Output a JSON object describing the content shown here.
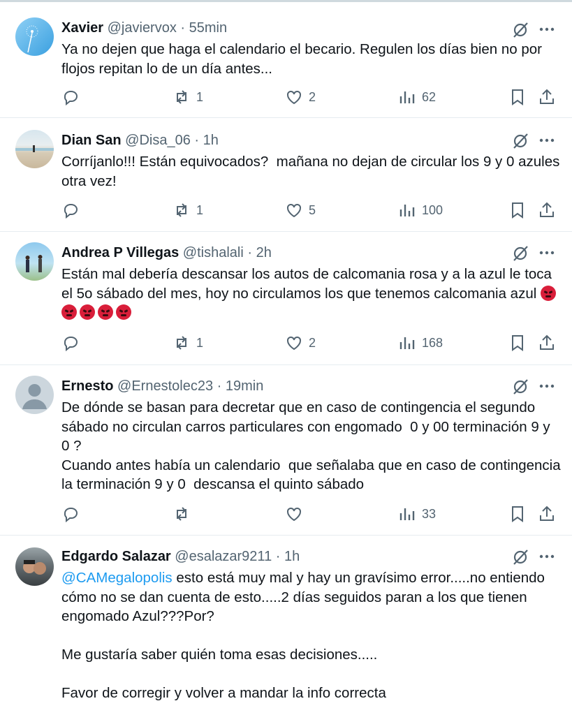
{
  "tweets": [
    {
      "name": "Xavier",
      "handle": "@javiervox",
      "time": "55min",
      "text": "Ya no dejen que haga el calendario el becario. Regulen los días bien no por flojos repitan lo de un día antes...",
      "replies": "",
      "retweets": "1",
      "likes": "2",
      "views": "62"
    },
    {
      "name": "Dian San",
      "handle": "@Disa_06",
      "time": "1h",
      "text": "Corríjanlo!!! Están equivocados?  mañana no dejan de circular los 9 y 0 azules otra vez!",
      "replies": "",
      "retweets": "1",
      "likes": "5",
      "views": "100"
    },
    {
      "name": "Andrea P Villegas",
      "handle": "@tishalali",
      "time": "2h",
      "text": "Están mal debería descansar los autos de calcomania rosa y a la azul le toca el 5o sábado del mes, hoy no circulamos los que tenemos calcomania azul ",
      "emoji_count": 5,
      "replies": "",
      "retweets": "1",
      "likes": "2",
      "views": "168"
    },
    {
      "name": "Ernesto",
      "handle": "@Ernestolec23",
      "time": "19min",
      "text": "De dónde se basan para decretar que en caso de contingencia el segundo sábado no circulan carros particulares con engomado  0 y 00 terminación 9 y 0 ?\nCuando antes había un calendario  que señalaba que en caso de contingencia la terminación 9 y 0  descansa el quinto sábado",
      "replies": "",
      "retweets": "",
      "likes": "",
      "views": "33"
    },
    {
      "name": "Edgardo Salazar",
      "handle": "@esalazar9211",
      "time": "1h",
      "mention": "@CAMegalopolis",
      "text": " esto está muy mal y hay un gravísimo error.....no entiendo cómo no se dan cuenta de esto.....2 días seguidos paran a los que tienen engomado Azul???Por?\n\nMe gustaría saber quién toma esas decisiones.....\n\nFavor de corregir y volver a mandar la info correcta",
      "replies": "",
      "retweets": "",
      "likes": "",
      "views": ""
    }
  ],
  "icons": {
    "reply": "reply-icon",
    "retweet": "retweet-icon",
    "like": "like-icon",
    "views": "views-icon",
    "bookmark": "bookmark-icon",
    "share": "share-icon",
    "grok": "grok-icon",
    "more": "more-icon"
  },
  "colors": {
    "text": "#0f1419",
    "secondary": "#536471",
    "mention": "#1d9bf0",
    "divider": "#e6ecf0"
  }
}
